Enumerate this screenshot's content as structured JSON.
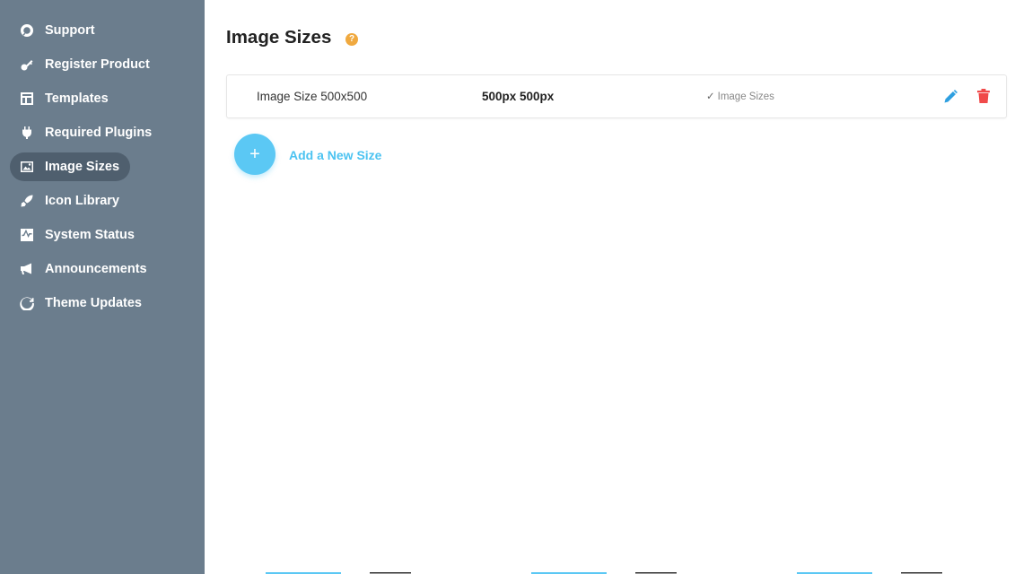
{
  "sidebar": {
    "items": [
      {
        "label": "Support",
        "icon": "lifebuoy-icon"
      },
      {
        "label": "Register Product",
        "icon": "key-icon"
      },
      {
        "label": "Templates",
        "icon": "layout-icon"
      },
      {
        "label": "Required Plugins",
        "icon": "plug-icon"
      },
      {
        "label": "Image Sizes",
        "icon": "image-icon",
        "active": true
      },
      {
        "label": "Icon Library",
        "icon": "rocket-icon"
      },
      {
        "label": "System Status",
        "icon": "activity-icon"
      },
      {
        "label": "Announcements",
        "icon": "megaphone-icon"
      },
      {
        "label": "Theme Updates",
        "icon": "refresh-icon"
      }
    ]
  },
  "main": {
    "title": "Image Sizes",
    "help_icon": "?",
    "sizes": [
      {
        "name": "Image Size 500x500",
        "dimensions": "500px 500px",
        "status": "Image Sizes",
        "status_icon": "✓"
      }
    ],
    "add_button_icon": "+",
    "add_label": "Add a New Size"
  },
  "colors": {
    "sidebar_bg": "#6b7d8d",
    "sidebar_active_bg": "#4f5f6e",
    "accent_blue": "#5bc8f4",
    "help_orange": "#f0a93f",
    "edit_blue": "#2e9fe0",
    "delete_red": "#f04a4a"
  }
}
